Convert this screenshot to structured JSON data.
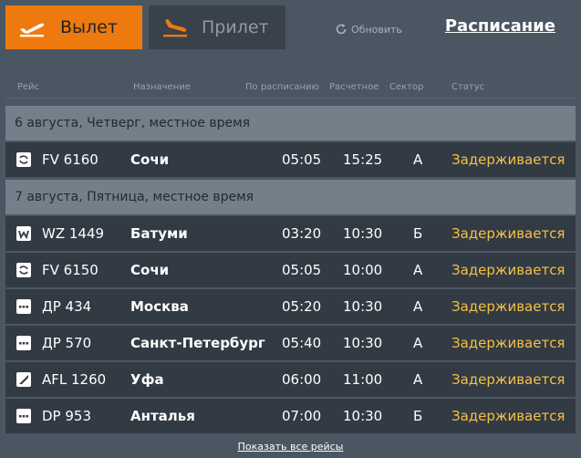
{
  "tabs": {
    "departures": {
      "label": "Вылет",
      "icon": "plane-takeoff-icon"
    },
    "arrivals": {
      "label": "Прилет",
      "icon": "plane-landing-icon"
    }
  },
  "refresh": {
    "label": "Обновить",
    "icon": "refresh-icon"
  },
  "schedule_link": "Расписание",
  "columns": {
    "flight": "Рейс",
    "destination": "Назначение",
    "scheduled": "По расписанию",
    "estimated": "Расчетное",
    "sector": "Сектор",
    "status": "Статус"
  },
  "groups": [
    {
      "date": "6 августа, Четверг, местное время",
      "flights": [
        {
          "airline_icon": "airline-logo-swirl",
          "flight": "FV 6160",
          "destination": "Сочи",
          "scheduled": "05:05",
          "estimated": "15:25",
          "sector": "А",
          "status": "Задерживается"
        }
      ]
    },
    {
      "date": "7 августа, Пятница, местное время",
      "flights": [
        {
          "airline_icon": "airline-logo-wizz",
          "flight": "WZ 1449",
          "destination": "Батуми",
          "scheduled": "03:20",
          "estimated": "10:30",
          "sector": "Б",
          "status": "Задерживается"
        },
        {
          "airline_icon": "airline-logo-swirl",
          "flight": "FV 6150",
          "destination": "Сочи",
          "scheduled": "05:05",
          "estimated": "10:00",
          "sector": "А",
          "status": "Задерживается"
        },
        {
          "airline_icon": "airline-logo-dots",
          "flight": "ДР 434",
          "destination": "Москва",
          "scheduled": "05:20",
          "estimated": "10:30",
          "sector": "А",
          "status": "Задерживается"
        },
        {
          "airline_icon": "airline-logo-dots",
          "flight": "ДР 570",
          "destination": "Санкт-Петербург",
          "scheduled": "05:40",
          "estimated": "10:30",
          "sector": "А",
          "status": "Задерживается"
        },
        {
          "airline_icon": "airline-logo-wing",
          "flight": "AFL 1260",
          "destination": "Уфа",
          "scheduled": "06:00",
          "estimated": "11:00",
          "sector": "А",
          "status": "Задерживается"
        },
        {
          "airline_icon": "airline-logo-dots",
          "flight": "DP 953",
          "destination": "Анталья",
          "scheduled": "07:00",
          "estimated": "10:30",
          "sector": "Б",
          "status": "Задерживается"
        }
      ]
    }
  ],
  "show_all_link": "Показать все рейсы",
  "colors": {
    "accent": "#ee7a0f",
    "status": "#f5c043",
    "background": "#4b5663",
    "row": "#323a44",
    "date_row": "#747f89"
  }
}
